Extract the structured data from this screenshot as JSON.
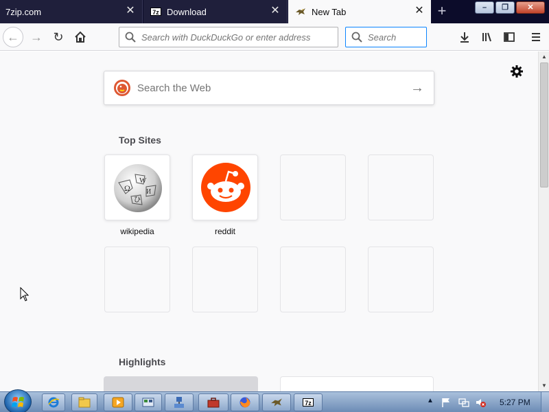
{
  "tabs": [
    {
      "title": "7zip.com",
      "close": "✕"
    },
    {
      "title": "Download",
      "close": "✕"
    },
    {
      "title": "New Tab",
      "close": "✕",
      "active": true
    }
  ],
  "new_tab_symbol": "+",
  "window_controls": {
    "minimize": "–",
    "maximize": "❐",
    "close": "✕"
  },
  "navbar": {
    "back_icon": "←",
    "forward_icon": "→",
    "reload_icon": "↻",
    "url_placeholder": "Search with DuckDuckGo or enter address",
    "search_placeholder": "Search"
  },
  "content": {
    "websearch_placeholder": "Search the Web",
    "websearch_go": "→",
    "top_sites_title": "Top Sites",
    "top_sites": [
      {
        "label": "wikipedia",
        "icon": "wikipedia-logo"
      },
      {
        "label": "reddit",
        "icon": "reddit-logo"
      }
    ],
    "highlights_title": "Highlights"
  },
  "taskbar": {
    "tray_chevron": "▲",
    "clock": "5:27 PM"
  },
  "colors": {
    "tabstrip_bg": "#0c0c2a",
    "active_tab_bg": "#f9f9fa",
    "focus_blue": "#0a84ff",
    "reddit_orange": "#ff4500",
    "ddg_orange": "#de5833"
  }
}
